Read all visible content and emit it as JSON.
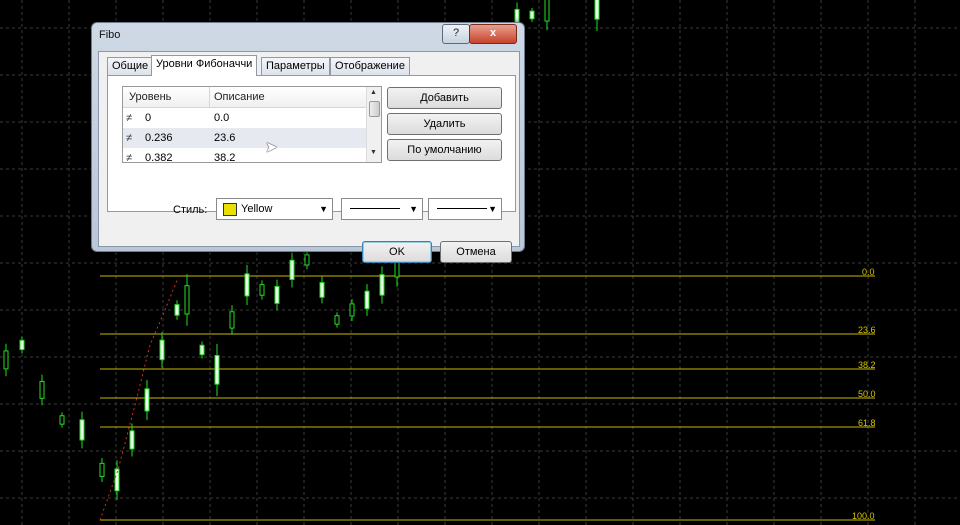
{
  "dialog": {
    "title": "Fibo",
    "help_label": "?",
    "close_label": "x",
    "tabs": [
      {
        "label": "Общие",
        "active": false
      },
      {
        "label": "Уровни Фибоначчи",
        "active": true
      },
      {
        "label": "Параметры",
        "active": false
      },
      {
        "label": "Отображение",
        "active": false
      }
    ],
    "levels_table": {
      "columns": [
        "Уровень",
        "Описание"
      ],
      "rows": [
        {
          "level": "0",
          "description": "0.0"
        },
        {
          "level": "0.236",
          "description": "23.6"
        },
        {
          "level": "0.382",
          "description": "38.2"
        }
      ],
      "row_icon": "level-line-icon"
    },
    "buttons": {
      "add": "Добавить",
      "delete": "Удалить",
      "default": "По умолчанию"
    },
    "style": {
      "label": "Стиль:",
      "color_name": "Yellow",
      "color": "#e8e000"
    },
    "ok_label": "OK",
    "cancel_label": "Отмена"
  },
  "chart": {
    "background": "#000000",
    "grid_color": "#3a3a3a",
    "candle_color": "#22dd22",
    "fib_color": "#c8b800",
    "fib_levels": [
      "0.0",
      "23.6",
      "38.2",
      "50.0",
      "61.8",
      "100.0"
    ]
  }
}
